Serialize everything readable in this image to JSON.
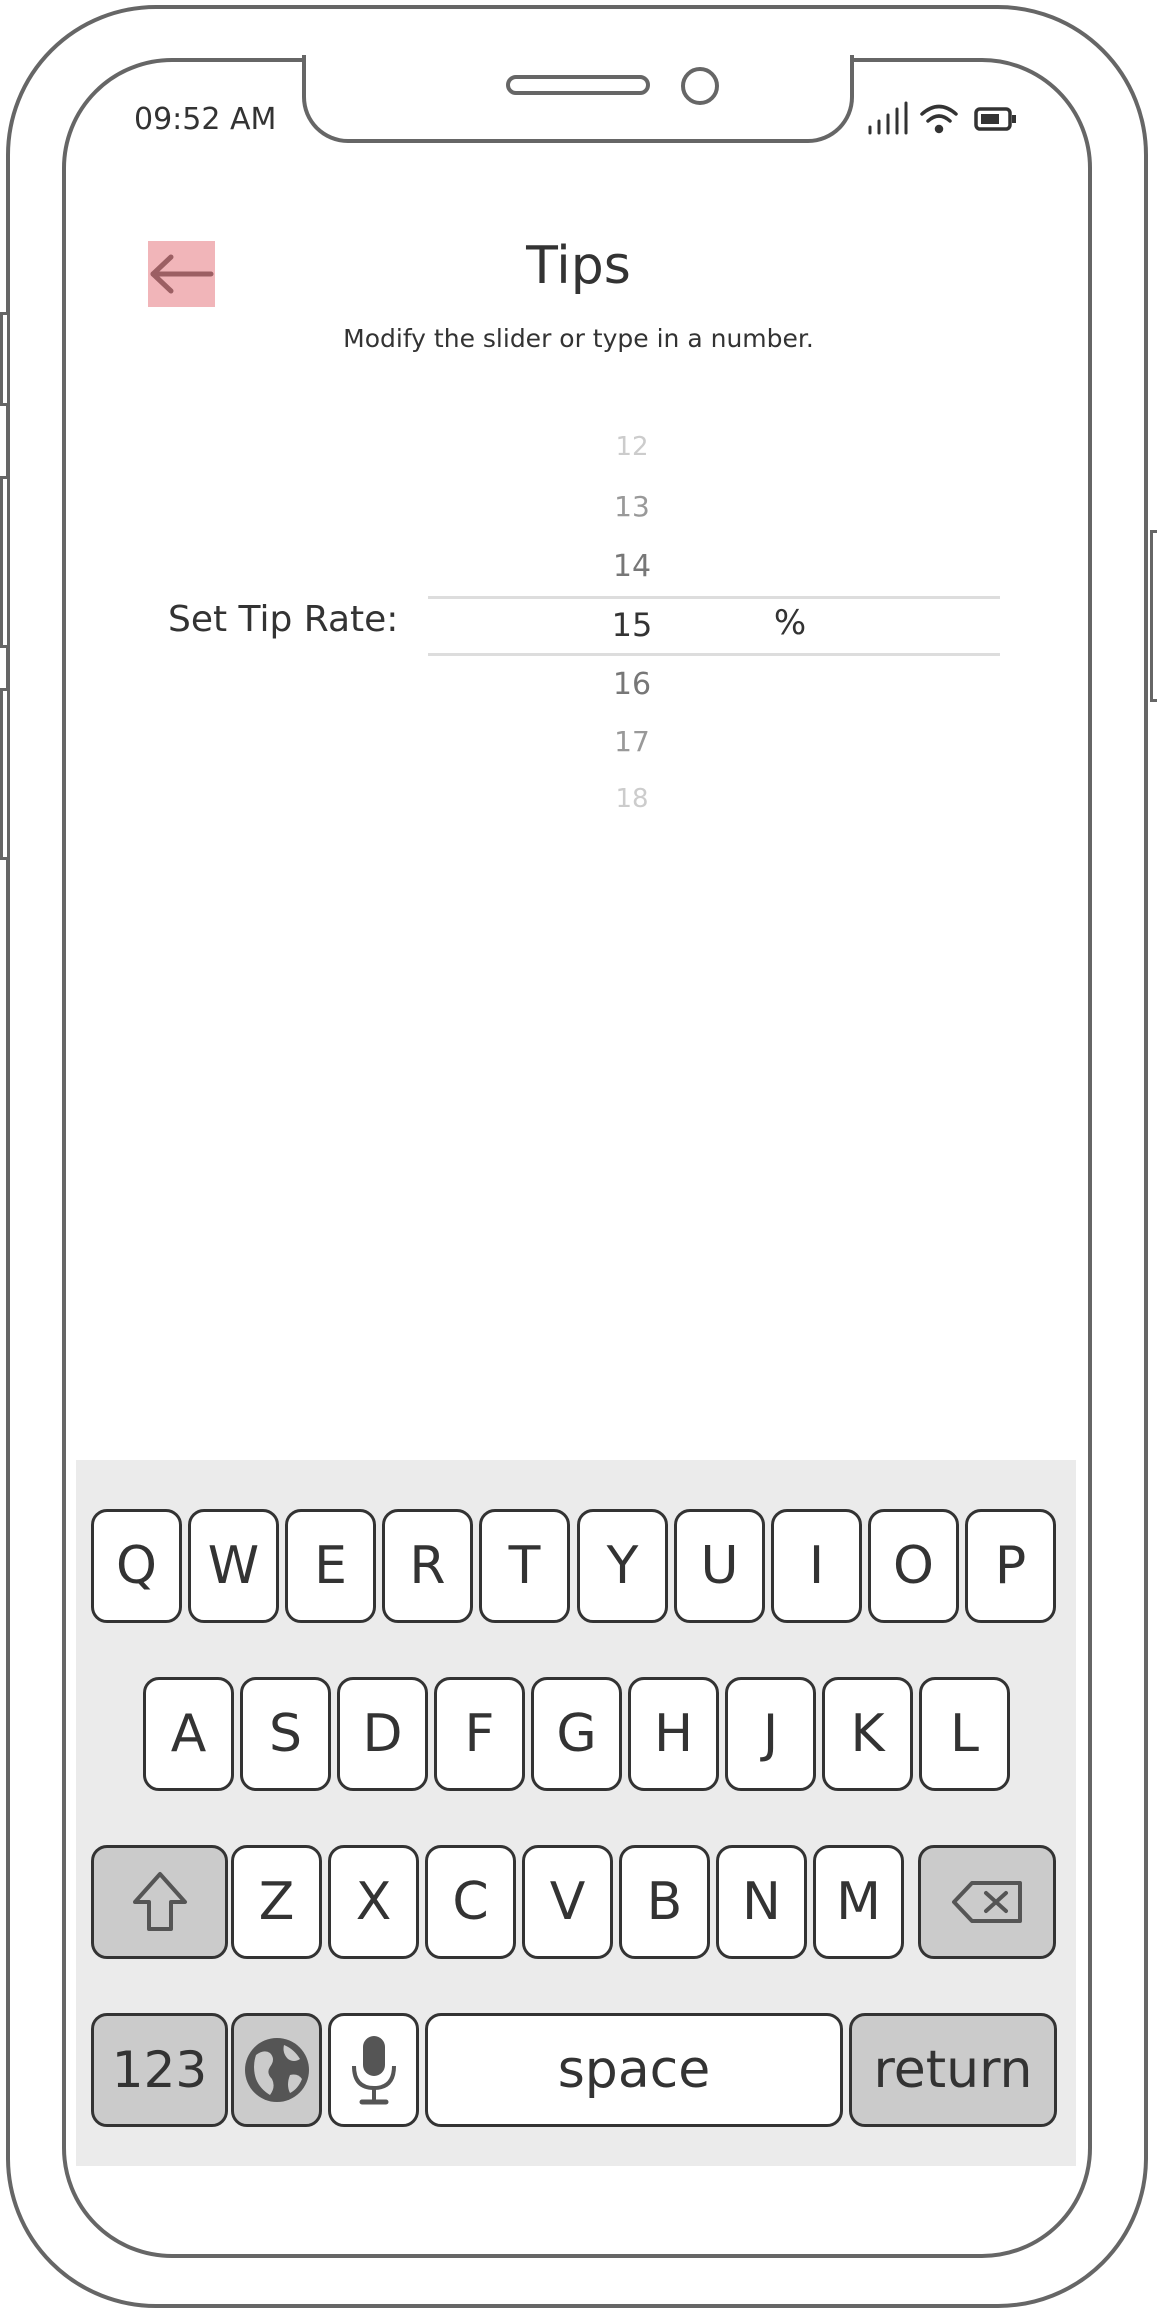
{
  "status_bar": {
    "time": "09:52 AM"
  },
  "header": {
    "title": "Tips",
    "subtitle": "Modify the slider or type in a number."
  },
  "tip_picker": {
    "label": "Set Tip Rate:",
    "values": [
      "12",
      "13",
      "14",
      "15",
      "16",
      "17",
      "18"
    ],
    "selected": "15",
    "unit": "%"
  },
  "keyboard": {
    "row1": [
      "Q",
      "W",
      "E",
      "R",
      "T",
      "Y",
      "U",
      "I",
      "O",
      "P"
    ],
    "row2": [
      "A",
      "S",
      "D",
      "F",
      "G",
      "H",
      "J",
      "K",
      "L"
    ],
    "row3": [
      "Z",
      "X",
      "C",
      "V",
      "B",
      "N",
      "M"
    ],
    "numbers_label": "123",
    "space_label": "space",
    "return_label": "return"
  },
  "colors": {
    "back_button_bg": "#f1b5b9",
    "back_arrow": "#9c5f63",
    "frame": "#666666",
    "keyboard_bg": "#ebebeb",
    "special_key_bg": "#cbcbcb"
  },
  "icons": {
    "back": "arrow-left-icon",
    "signal": "cellular-signal-icon",
    "wifi": "wifi-icon",
    "battery": "battery-icon",
    "shift": "shift-arrow-icon",
    "delete": "backspace-icon",
    "globe": "globe-icon",
    "mic": "microphone-icon"
  }
}
